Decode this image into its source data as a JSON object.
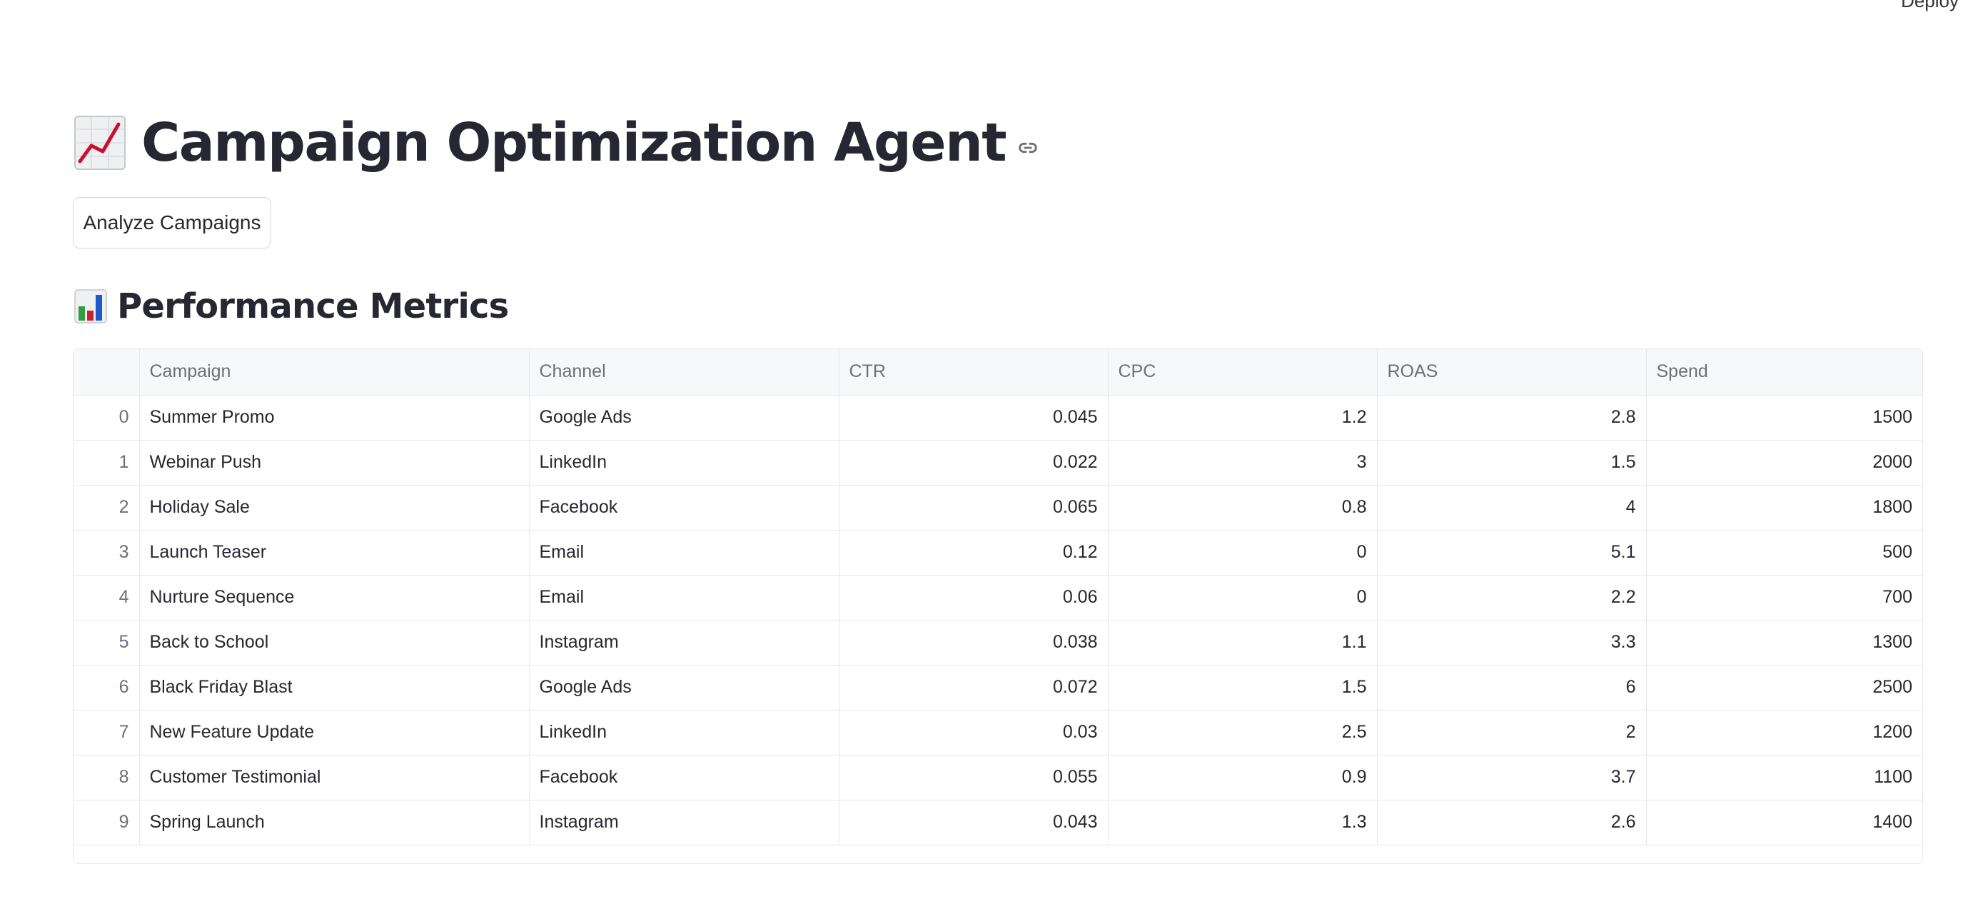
{
  "header": {
    "deploy_label": "Deploy"
  },
  "main": {
    "title": "Campaign Optimization Agent",
    "title_icon": "chart-increasing-icon",
    "anchor_icon": "link-icon",
    "analyze_button_label": "Analyze Campaigns",
    "section_title": "Performance Metrics",
    "section_icon": "bar-chart-icon"
  },
  "table": {
    "columns": [
      "",
      "Campaign",
      "Channel",
      "CTR",
      "CPC",
      "ROAS",
      "Spend"
    ],
    "rows": [
      {
        "index": "0",
        "campaign": "Summer Promo",
        "channel": "Google Ads",
        "ctr": "0.045",
        "cpc": "1.2",
        "roas": "2.8",
        "spend": "1500"
      },
      {
        "index": "1",
        "campaign": "Webinar Push",
        "channel": "LinkedIn",
        "ctr": "0.022",
        "cpc": "3",
        "roas": "1.5",
        "spend": "2000"
      },
      {
        "index": "2",
        "campaign": "Holiday Sale",
        "channel": "Facebook",
        "ctr": "0.065",
        "cpc": "0.8",
        "roas": "4",
        "spend": "1800"
      },
      {
        "index": "3",
        "campaign": "Launch Teaser",
        "channel": "Email",
        "ctr": "0.12",
        "cpc": "0",
        "roas": "5.1",
        "spend": "500"
      },
      {
        "index": "4",
        "campaign": "Nurture Sequence",
        "channel": "Email",
        "ctr": "0.06",
        "cpc": "0",
        "roas": "2.2",
        "spend": "700"
      },
      {
        "index": "5",
        "campaign": "Back to School",
        "channel": "Instagram",
        "ctr": "0.038",
        "cpc": "1.1",
        "roas": "3.3",
        "spend": "1300"
      },
      {
        "index": "6",
        "campaign": "Black Friday Blast",
        "channel": "Google Ads",
        "ctr": "0.072",
        "cpc": "1.5",
        "roas": "6",
        "spend": "2500"
      },
      {
        "index": "7",
        "campaign": "New Feature Update",
        "channel": "LinkedIn",
        "ctr": "0.03",
        "cpc": "2.5",
        "roas": "2",
        "spend": "1200"
      },
      {
        "index": "8",
        "campaign": "Customer Testimonial",
        "channel": "Facebook",
        "ctr": "0.055",
        "cpc": "0.9",
        "roas": "3.7",
        "spend": "1100"
      },
      {
        "index": "9",
        "campaign": "Spring Launch",
        "channel": "Instagram",
        "ctr": "0.043",
        "cpc": "1.3",
        "roas": "2.6",
        "spend": "1400"
      }
    ]
  }
}
